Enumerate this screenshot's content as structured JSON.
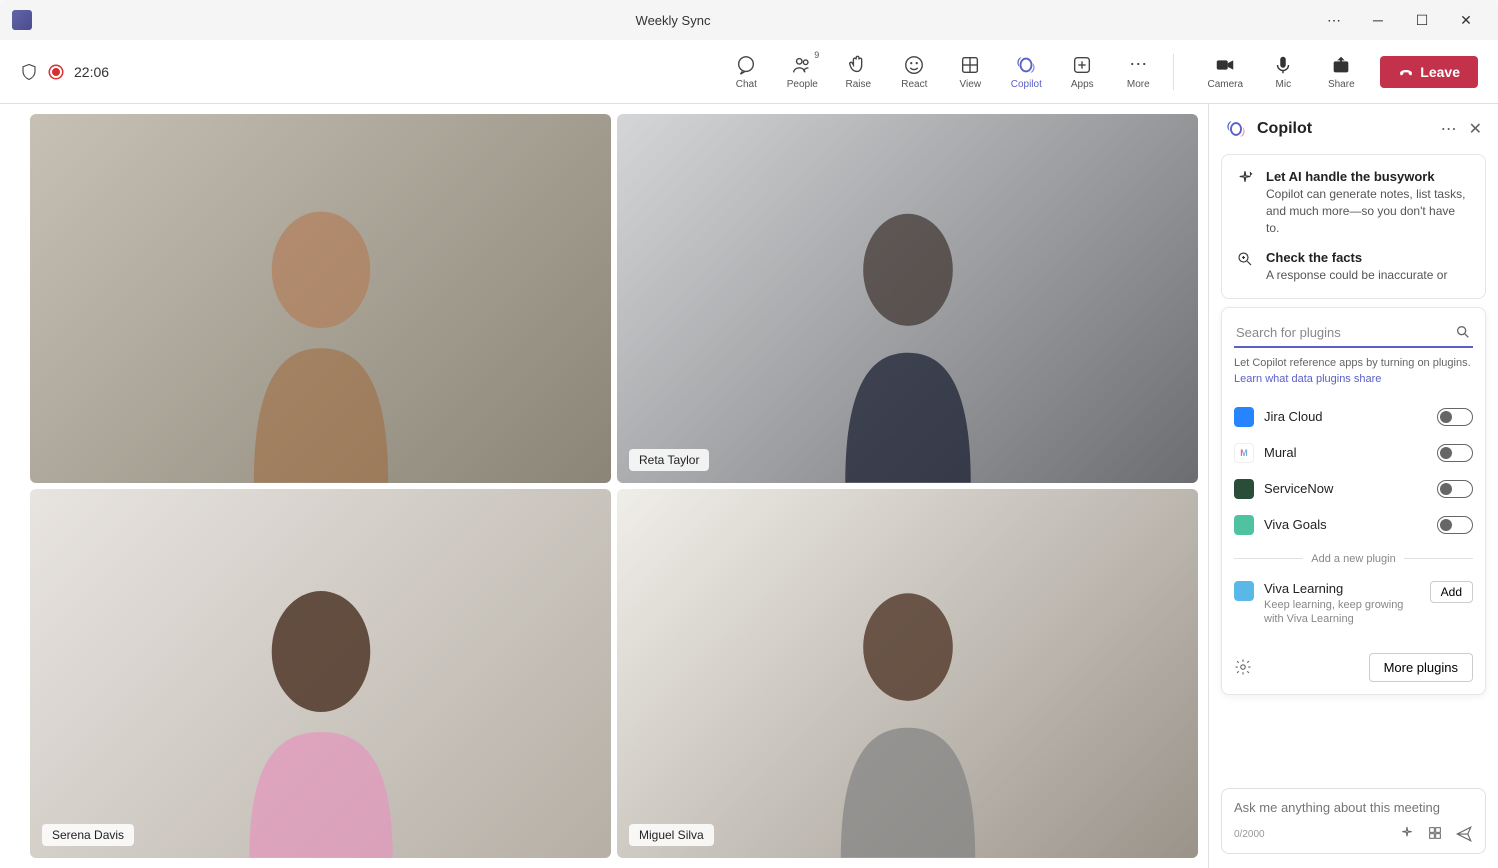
{
  "titlebar": {
    "meeting_name": "Weekly Sync"
  },
  "recording": {
    "timer": "22:06"
  },
  "toolbar": {
    "chat": "Chat",
    "people": "People",
    "people_count": "9",
    "raise": "Raise",
    "react": "React",
    "view": "View",
    "copilot": "Copilot",
    "apps": "Apps",
    "more": "More",
    "camera": "Camera",
    "mic": "Mic",
    "share": "Share",
    "leave": "Leave"
  },
  "participants": [
    {
      "name": ""
    },
    {
      "name": "Reta Taylor"
    },
    {
      "name": "Serena Davis"
    },
    {
      "name": "Miguel Silva"
    }
  ],
  "copilot": {
    "title": "Copilot",
    "tips": [
      {
        "title": "Let AI handle the busywork",
        "desc": "Copilot can generate notes, list tasks, and much more—so you don't have to."
      },
      {
        "title": "Check the facts",
        "desc": "A response could be inaccurate or"
      }
    ],
    "search_placeholder": "Search for plugins",
    "plugin_note_text": "Let Copilot reference apps by turning on plugins.",
    "plugin_note_link": "Learn what data plugins share",
    "plugins": [
      {
        "name": "Jira Cloud",
        "color": "#2684ff"
      },
      {
        "name": "Mural",
        "color": "#ff4d6a"
      },
      {
        "name": "ServiceNow",
        "color": "#2a4d3a"
      },
      {
        "name": "Viva Goals",
        "color": "#4fc3a1"
      }
    ],
    "divider_text": "Add a new plugin",
    "suggestion": {
      "name": "Viva Learning",
      "desc": "Keep learning, keep growing with Viva Learning",
      "add": "Add",
      "color": "#59b8e8"
    },
    "more_plugins": "More plugins",
    "compose_placeholder": "Ask me anything about this meeting",
    "compose_count": "0/2000"
  }
}
